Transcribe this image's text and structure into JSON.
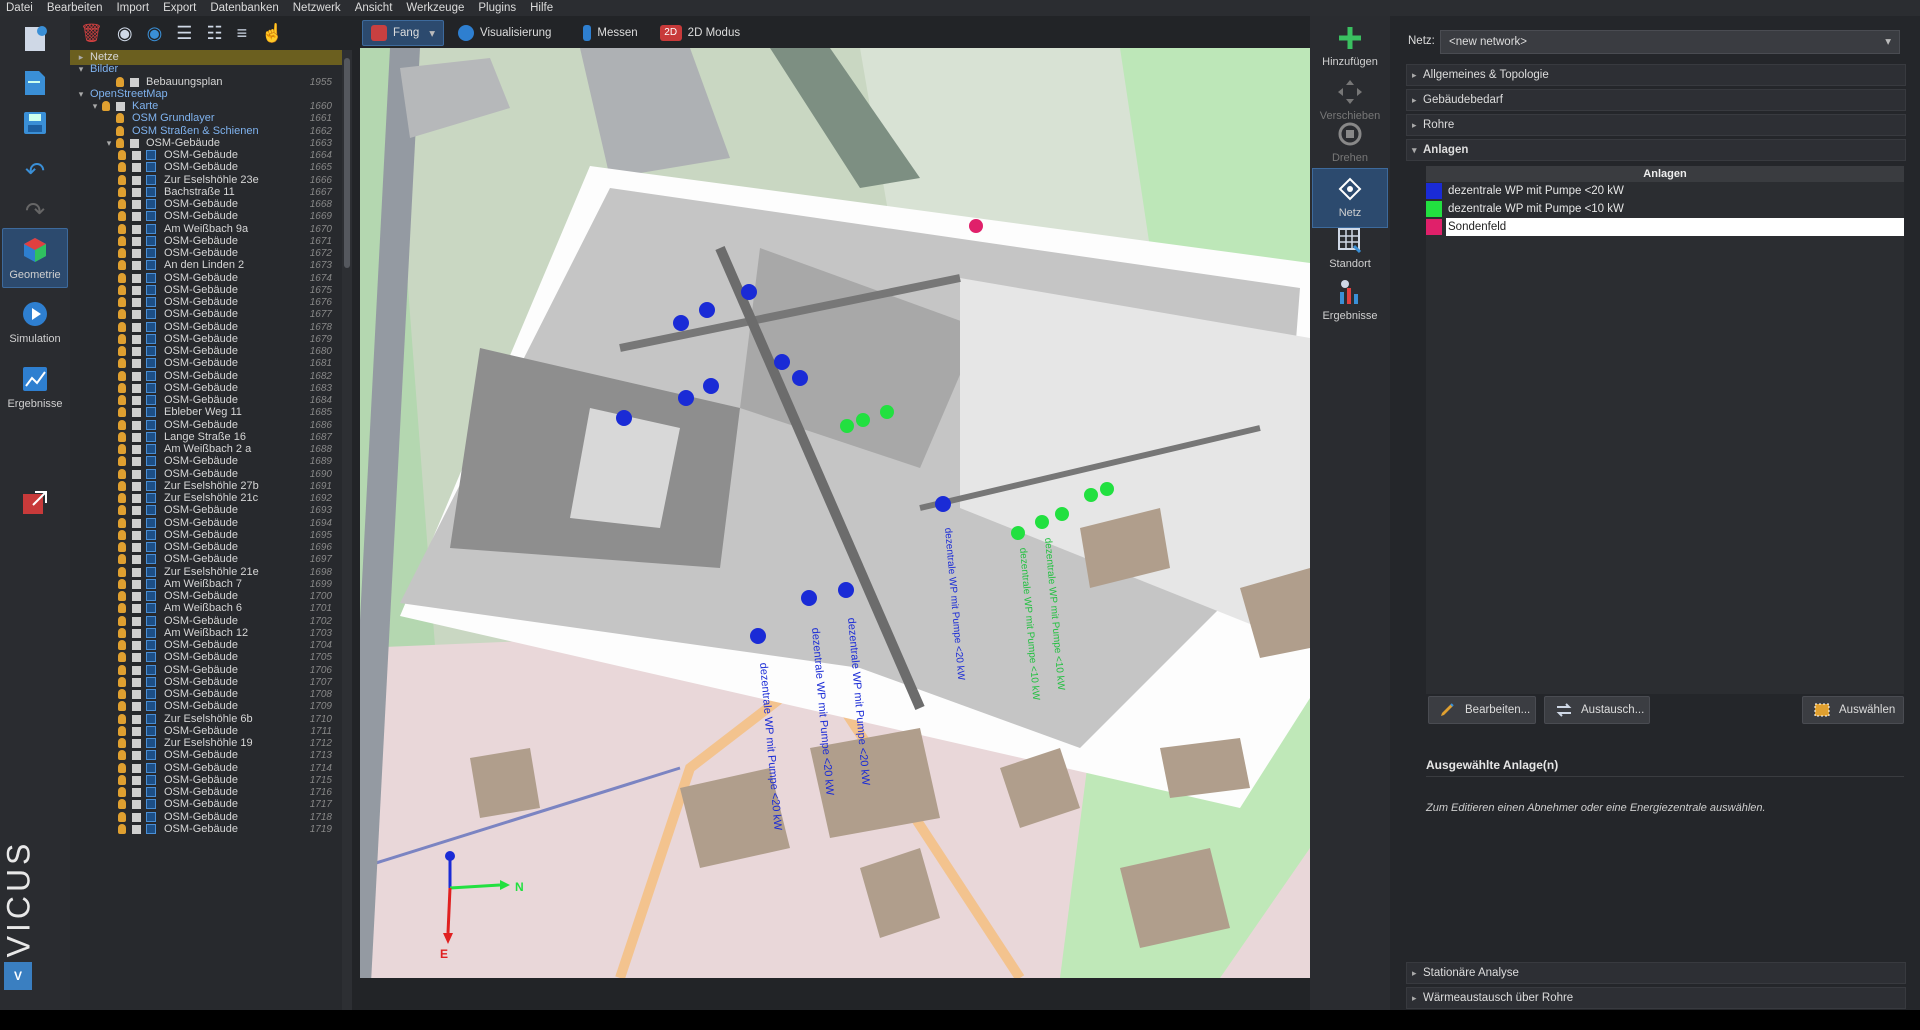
{
  "menu": [
    "Datei",
    "Bearbeiten",
    "Import",
    "Export",
    "Datenbanken",
    "Netzwerk",
    "Ansicht",
    "Werkzeuge",
    "Plugins",
    "Hilfe"
  ],
  "left_modes": [
    {
      "label": "Geometrie",
      "active": true
    },
    {
      "label": "Simulation",
      "active": false
    },
    {
      "label": "Ergebnisse",
      "active": false
    }
  ],
  "brand": "VICUS",
  "view_toolbar": {
    "fang": "Fang",
    "visualisierung": "Visualisierung",
    "messen": "Messen",
    "modus2d": "2D Modus"
  },
  "tree": [
    {
      "label": "Netze",
      "depth": 0,
      "arrow": "▸",
      "sel": true
    },
    {
      "label": "Bilder",
      "depth": 0,
      "arrow": "▾",
      "blue": true
    },
    {
      "label": "Bebauungsplan",
      "depth": 2,
      "num": "1955",
      "icons": "bc"
    },
    {
      "label": "OpenStreetMap",
      "depth": 0,
      "arrow": "▾",
      "blue": true
    },
    {
      "label": "Karte",
      "depth": 1,
      "arrow": "▾",
      "num": "1660",
      "icons": "bc",
      "blue": true
    },
    {
      "label": "OSM Grundlayer",
      "depth": 2,
      "num": "1661",
      "icons": "b",
      "blue": true
    },
    {
      "label": "OSM Straßen & Schienen",
      "depth": 2,
      "num": "1662",
      "icons": "b",
      "blue": true
    },
    {
      "label": "OSM-Gebäude",
      "depth": 2,
      "arrow": "▾",
      "num": "1663",
      "icons": "bc"
    },
    {
      "label": "OSM-Gebäude",
      "depth": 3,
      "num": "1664",
      "icons": "bcg"
    },
    {
      "label": "OSM-Gebäude",
      "depth": 3,
      "num": "1665",
      "icons": "bcg"
    },
    {
      "label": "Zur Eselshöhle 23e",
      "depth": 3,
      "num": "1666",
      "icons": "bcg"
    },
    {
      "label": "Bachstraße 11",
      "depth": 3,
      "num": "1667",
      "icons": "bcg"
    },
    {
      "label": "OSM-Gebäude",
      "depth": 3,
      "num": "1668",
      "icons": "bcg"
    },
    {
      "label": "OSM-Gebäude",
      "depth": 3,
      "num": "1669",
      "icons": "bcg"
    },
    {
      "label": "Am Weißbach 9a",
      "depth": 3,
      "num": "1670",
      "icons": "bcg"
    },
    {
      "label": "OSM-Gebäude",
      "depth": 3,
      "num": "1671",
      "icons": "bcg"
    },
    {
      "label": "OSM-Gebäude",
      "depth": 3,
      "num": "1672",
      "icons": "bcg"
    },
    {
      "label": "An den Linden 2",
      "depth": 3,
      "num": "1673",
      "icons": "bcg"
    },
    {
      "label": "OSM-Gebäude",
      "depth": 3,
      "num": "1674",
      "icons": "bcg"
    },
    {
      "label": "OSM-Gebäude",
      "depth": 3,
      "num": "1675",
      "icons": "bcg"
    },
    {
      "label": "OSM-Gebäude",
      "depth": 3,
      "num": "1676",
      "icons": "bcg"
    },
    {
      "label": "OSM-Gebäude",
      "depth": 3,
      "num": "1677",
      "icons": "bcg"
    },
    {
      "label": "OSM-Gebäude",
      "depth": 3,
      "num": "1678",
      "icons": "bcg"
    },
    {
      "label": "OSM-Gebäude",
      "depth": 3,
      "num": "1679",
      "icons": "bcg"
    },
    {
      "label": "OSM-Gebäude",
      "depth": 3,
      "num": "1680",
      "icons": "bcg"
    },
    {
      "label": "OSM-Gebäude",
      "depth": 3,
      "num": "1681",
      "icons": "bcg"
    },
    {
      "label": "OSM-Gebäude",
      "depth": 3,
      "num": "1682",
      "icons": "bcg"
    },
    {
      "label": "OSM-Gebäude",
      "depth": 3,
      "num": "1683",
      "icons": "bcg"
    },
    {
      "label": "OSM-Gebäude",
      "depth": 3,
      "num": "1684",
      "icons": "bcg"
    },
    {
      "label": "Ebleber Weg 11",
      "depth": 3,
      "num": "1685",
      "icons": "bcg"
    },
    {
      "label": "OSM-Gebäude",
      "depth": 3,
      "num": "1686",
      "icons": "bcg"
    },
    {
      "label": "Lange Straße 16",
      "depth": 3,
      "num": "1687",
      "icons": "bcg"
    },
    {
      "label": "Am Weißbach 2 a",
      "depth": 3,
      "num": "1688",
      "icons": "bcg"
    },
    {
      "label": "OSM-Gebäude",
      "depth": 3,
      "num": "1689",
      "icons": "bcg"
    },
    {
      "label": "OSM-Gebäude",
      "depth": 3,
      "num": "1690",
      "icons": "bcg"
    },
    {
      "label": "Zur Eselshöhle 27b",
      "depth": 3,
      "num": "1691",
      "icons": "bcg"
    },
    {
      "label": "Zur Eselshöhle 21c",
      "depth": 3,
      "num": "1692",
      "icons": "bcg"
    },
    {
      "label": "OSM-Gebäude",
      "depth": 3,
      "num": "1693",
      "icons": "bcg"
    },
    {
      "label": "OSM-Gebäude",
      "depth": 3,
      "num": "1694",
      "icons": "bcg"
    },
    {
      "label": "OSM-Gebäude",
      "depth": 3,
      "num": "1695",
      "icons": "bcg"
    },
    {
      "label": "OSM-Gebäude",
      "depth": 3,
      "num": "1696",
      "icons": "bcg"
    },
    {
      "label": "OSM-Gebäude",
      "depth": 3,
      "num": "1697",
      "icons": "bcg"
    },
    {
      "label": "Zur Eselshöhle 21e",
      "depth": 3,
      "num": "1698",
      "icons": "bcg"
    },
    {
      "label": "Am Weißbach 7",
      "depth": 3,
      "num": "1699",
      "icons": "bcg"
    },
    {
      "label": "OSM-Gebäude",
      "depth": 3,
      "num": "1700",
      "icons": "bcg"
    },
    {
      "label": "Am Weißbach 6",
      "depth": 3,
      "num": "1701",
      "icons": "bcg"
    },
    {
      "label": "OSM-Gebäude",
      "depth": 3,
      "num": "1702",
      "icons": "bcg"
    },
    {
      "label": "Am Weißbach 12",
      "depth": 3,
      "num": "1703",
      "icons": "bcg"
    },
    {
      "label": "OSM-Gebäude",
      "depth": 3,
      "num": "1704",
      "icons": "bcg"
    },
    {
      "label": "OSM-Gebäude",
      "depth": 3,
      "num": "1705",
      "icons": "bcg"
    },
    {
      "label": "OSM-Gebäude",
      "depth": 3,
      "num": "1706",
      "icons": "bcg"
    },
    {
      "label": "OSM-Gebäude",
      "depth": 3,
      "num": "1707",
      "icons": "bcg"
    },
    {
      "label": "OSM-Gebäude",
      "depth": 3,
      "num": "1708",
      "icons": "bcg"
    },
    {
      "label": "OSM-Gebäude",
      "depth": 3,
      "num": "1709",
      "icons": "bcg"
    },
    {
      "label": "Zur Eselshöhle 6b",
      "depth": 3,
      "num": "1710",
      "icons": "bcg"
    },
    {
      "label": "OSM-Gebäude",
      "depth": 3,
      "num": "1711",
      "icons": "bcg"
    },
    {
      "label": "Zur Eselshöhle 19",
      "depth": 3,
      "num": "1712",
      "icons": "bcg"
    },
    {
      "label": "OSM-Gebäude",
      "depth": 3,
      "num": "1713",
      "icons": "bcg"
    },
    {
      "label": "OSM-Gebäude",
      "depth": 3,
      "num": "1714",
      "icons": "bcg"
    },
    {
      "label": "OSM-Gebäude",
      "depth": 3,
      "num": "1715",
      "icons": "bcg"
    },
    {
      "label": "OSM-Gebäude",
      "depth": 3,
      "num": "1716",
      "icons": "bcg"
    },
    {
      "label": "OSM-Gebäude",
      "depth": 3,
      "num": "1717",
      "icons": "bcg"
    },
    {
      "label": "OSM-Gebäude",
      "depth": 3,
      "num": "1718",
      "icons": "bcg"
    },
    {
      "label": "OSM-Gebäude",
      "depth": 3,
      "num": "1719",
      "icons": "bcg"
    }
  ],
  "right_tools": [
    {
      "label": "Hinzufügen",
      "state": "normal"
    },
    {
      "label": "Verschieben",
      "state": "dim"
    },
    {
      "label": "Drehen",
      "state": "dim"
    },
    {
      "label": "Netz",
      "state": "active"
    },
    {
      "label": "Standort",
      "state": "normal"
    },
    {
      "label": "Ergebnisse",
      "state": "normal"
    }
  ],
  "panel": {
    "netz_label": "Netz:",
    "netz_value": "<new network>",
    "sections_top": [
      "Allgemeines & Topologie",
      "Gebäudebedarf",
      "Rohre"
    ],
    "open_section": "Anlagen",
    "table_header": "Anlagen",
    "anlagen": [
      {
        "label": "dezentrale WP mit Pumpe <20 kW",
        "color": "#1a2bd6"
      },
      {
        "label": "dezentrale WP mit Pumpe <10 kW",
        "color": "#22e040"
      },
      {
        "label": "Sondenfeld",
        "color": "#e0206a",
        "selected": true
      }
    ],
    "buttons": {
      "bearbeiten": "Bearbeiten...",
      "austausch": "Austausch...",
      "auswaehlen": "Auswählen"
    },
    "selected_title": "Ausgewählte Anlage(n)",
    "selected_hint": "Zum Editieren einen Abnehmer oder eine Energiezentrale auswählen.",
    "sections_bottom": [
      "Stationäre Analyse",
      "Wärmeaustausch über Rohre"
    ]
  },
  "viewport": {
    "labels_blue": [
      "dezentrale WP mit Pumpe <20 kW",
      "dezentrale WP mit Pumpe <20 kW",
      "dezentrale WP mit Pumpe <20 kW",
      "dezentrale WP mit Pumpe <20 kW"
    ],
    "labels_green": [
      "dezentrale WP mit Pumpe <10 kW",
      "dezentrale WP mit Pumpe <10 kW"
    ],
    "axis_n": "N",
    "axis_e": "E"
  }
}
